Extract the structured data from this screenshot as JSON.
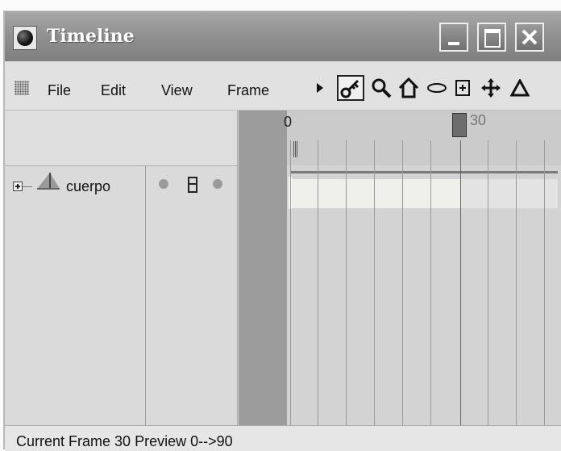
{
  "window": {
    "title": "Timeline"
  },
  "menu": {
    "file": "File",
    "edit": "Edit",
    "view": "View",
    "frame": "Frame"
  },
  "toolbar": {
    "icons": [
      "play-arrow-icon",
      "key-icon",
      "zoom-icon",
      "home-icon",
      "ellipse-icon",
      "insert-frame-icon",
      "move-icon",
      "triangle-icon"
    ],
    "selected": "key-icon"
  },
  "objects": [
    {
      "name": "cuerpo"
    }
  ],
  "ruler": {
    "start_label": "0",
    "current_label": "30"
  },
  "status": {
    "label": "Current Frame",
    "current_frame": "30",
    "preview_label": "Preview",
    "preview_range": "0-->90"
  }
}
